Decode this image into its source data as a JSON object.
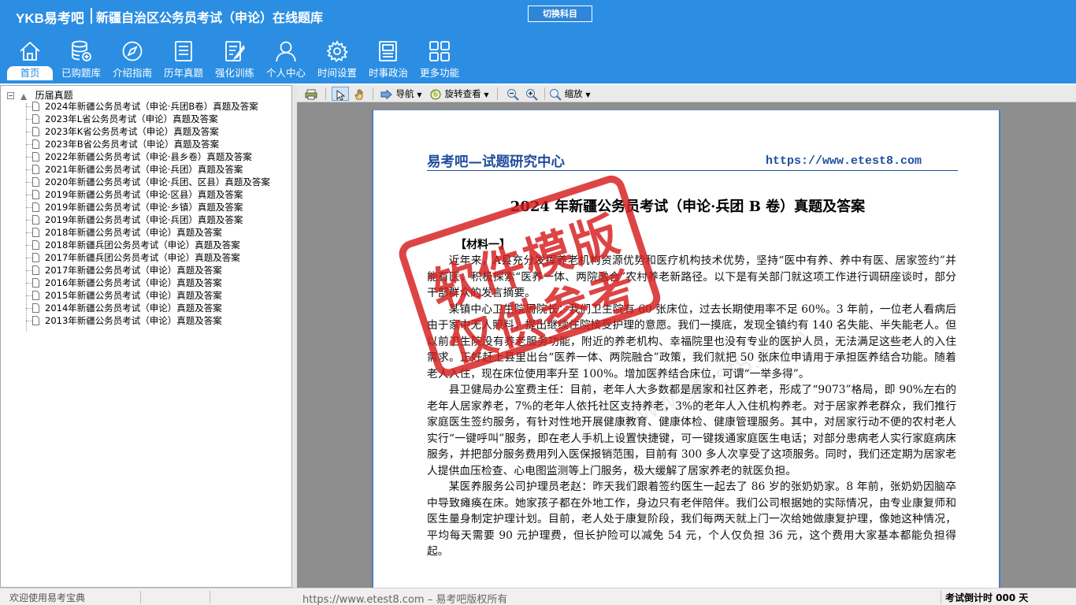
{
  "header": {
    "logo": "YKB易考吧",
    "title": "新疆自治区公务员考试（申论）在线题库",
    "switch_button": "切换科目"
  },
  "nav": [
    {
      "label": "首页",
      "icon": "home-icon",
      "active": true
    },
    {
      "label": "已购题库",
      "icon": "database-icon"
    },
    {
      "label": "介绍指南",
      "icon": "compass-icon"
    },
    {
      "label": "历年真题",
      "icon": "document-list-icon"
    },
    {
      "label": "强化训练",
      "icon": "edit-icon"
    },
    {
      "label": "个人中心",
      "icon": "user-icon"
    },
    {
      "label": "时间设置",
      "icon": "gear-icon"
    },
    {
      "label": "时事政治",
      "icon": "newspaper-icon"
    },
    {
      "label": "更多功能",
      "icon": "grid-icon"
    }
  ],
  "tree": {
    "root": "历届真题",
    "items": [
      "2024年新疆公务员考试（申论·兵团B卷）真题及答案",
      "2023年L省公务员考试（申论）真题及答案",
      "2023年K省公务员考试（申论）真题及答案",
      "2023年B省公务员考试（申论）真题及答案",
      "2022年新疆公务员考试（申论·县乡卷）真题及答案",
      "2021年新疆公务员考试（申论·兵团）真题及答案",
      "2020年新疆公务员考试（申论·兵团、区县）真题及答案",
      "2019年新疆公务员考试（申论·区县）真题及答案",
      "2019年新疆公务员考试（申论·乡镇）真题及答案",
      "2019年新疆公务员考试（申论·兵团）真题及答案",
      "2018年新疆公务员考试（申论）真题及答案",
      "2018年新疆兵团公务员考试（申论）真题及答案",
      "2017年新疆兵团公务员考试（申论）真题及答案",
      "2017年新疆公务员考试（申论）真题及答案",
      "2016年新疆公务员考试（申论）真题及答案",
      "2015年新疆公务员考试（申论）真题及答案",
      "2014年新疆公务员考试（申论）真题及答案",
      "2013年新疆公务员考试（申论）真题及答案"
    ]
  },
  "toolbar": {
    "navigate": "导航",
    "rotate": "旋转查看",
    "zoom": "缩放"
  },
  "document": {
    "header_left": "易考吧—试题研究中心",
    "header_right": "https://www.etest8.com",
    "title": "2024 年新疆公务员考试（申论·兵团 B 卷）真题及答案",
    "section": "【材料一】",
    "paragraphs": [
      "近年来，A县充分发挥养老机构资源优势和医疗机构技术优势，坚持“医中有养、养中有医、居家签约”并能有医，积极探索“医养一体、两院融合”农村养老新路径。以下是有关部门就这项工作进行调研座谈时，部分干部群众的发言摘要。",
      "某镇中心卫生院周院长：我们卫生院有 60 张床位，过去长期使用率不足 60%。3 年前，一位老人看病后由于家中无人照料，提出继续住院接受护理的意愿。我们一摸底，发现全镇约有 140 名失能、半失能老人。但以前卫生院没有养老服务功能，附近的养老机构、幸福院里也没有专业的医护人员，无法满足这些老人的入住需求。正好赶上县里出台“医养一体、两院融合”政策，我们就把 50 张床位申请用于承担医养结合功能。随着老人入住，现在床位使用率升至 100%。增加医养结合床位，可谓“一举多得”。",
      "县卫健局办公室费主任：目前，老年人大多数都是居家和社区养老，形成了“9073”格局，即 90%左右的老年人居家养老，7%的老年人依托社区支持养老，3%的老年人入住机构养老。对于居家养老群众，我们推行家庭医生签约服务，有针对性地开展健康教育、健康体检、健康管理服务。其中，对居家行动不便的农村老人实行“一键呼叫”服务，即在老人手机上设置快捷键，可一键拨通家庭医生电话；对部分患病老人实行家庭病床服务，并把部分服务费用列入医保报销范围，目前有 300 多人次享受了这项服务。同时，我们还定期为居家老人提供血压检查、心电图监测等上门服务，极大缓解了居家养老的就医负担。",
      "某医养服务公司护理员老赵：昨天我们跟着签约医生一起去了 86 岁的张奶奶家。8 年前，张奶奶因脑卒中导致瘫痪在床。她家孩子都在外地工作，身边只有老伴陪伴。我们公司根据她的实际情况，由专业康复师和医生量身制定护理计划。目前，老人处于康复阶段，我们每两天就上门一次给她做康复护理，像她这种情况，平均每天需要 90 元护理费，但长护险可以减免 54 元，个人仅负担 36 元，这个费用大家基本都能负担得起。"
    ],
    "stamp_line1": "软件模版",
    "stamp_line2": "仅供参考",
    "watermark": "www.etest8.com"
  },
  "status": {
    "left": "欢迎使用易考宝典",
    "middle": "https://www.etest8.com – 易考吧版权所有",
    "right": "考试倒计时 000 天"
  },
  "colors": {
    "header_bg": "#2b8ee3",
    "doc_blue": "#1f4e9c",
    "stamp_red": "#d61c1c"
  }
}
